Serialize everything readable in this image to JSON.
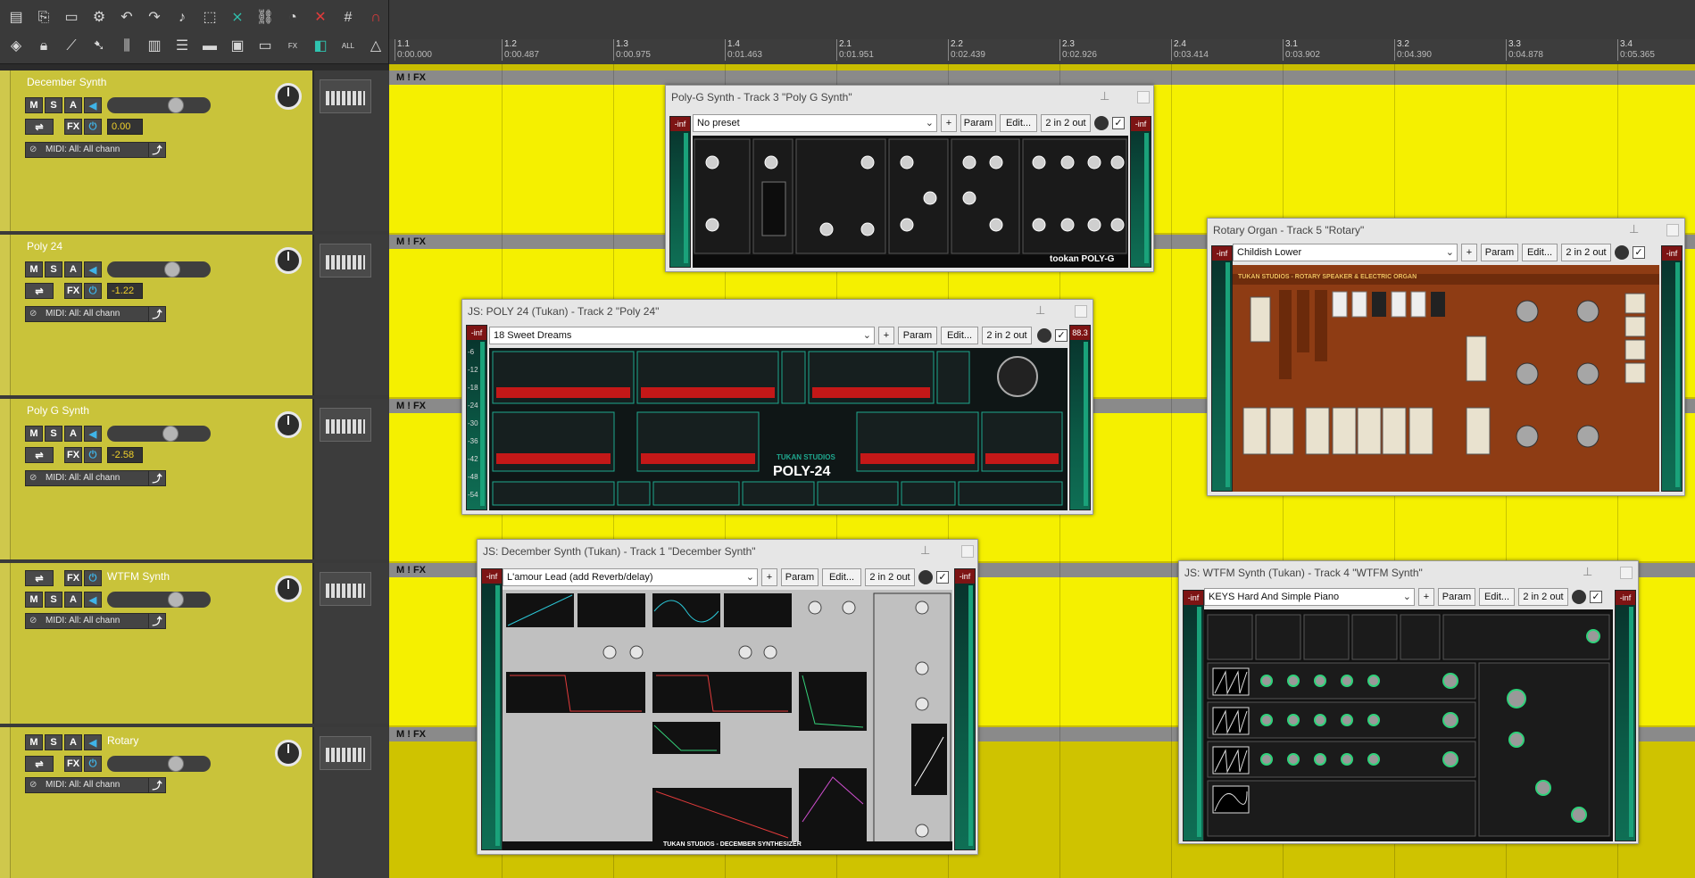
{
  "ruler": {
    "markers": [
      {
        "bar": "1.1",
        "time": "0:00.000"
      },
      {
        "bar": "1.2",
        "time": "0:00.487"
      },
      {
        "bar": "1.3",
        "time": "0:00.975"
      },
      {
        "bar": "1.4",
        "time": "0:01.463"
      },
      {
        "bar": "2.1",
        "time": "0:01.951"
      },
      {
        "bar": "2.2",
        "time": "0:02.439"
      },
      {
        "bar": "2.3",
        "time": "0:02.926"
      },
      {
        "bar": "2.4",
        "time": "0:03.414"
      },
      {
        "bar": "3.1",
        "time": "0:03.902"
      },
      {
        "bar": "3.2",
        "time": "0:04.390"
      },
      {
        "bar": "3.3",
        "time": "0:04.878"
      },
      {
        "bar": "3.4",
        "time": "0:05.365"
      }
    ]
  },
  "tracks": [
    {
      "name": "December Synth",
      "pan": "0.00",
      "midi": "MIDI: All: All chann"
    },
    {
      "name": "Poly 24",
      "pan": "-1.22",
      "midi": "MIDI: All: All chann"
    },
    {
      "name": "Poly G Synth",
      "pan": "-2.58",
      "midi": "MIDI: All: All chann"
    },
    {
      "name": "WTFM Synth",
      "midi": "MIDI: All: All chann"
    },
    {
      "name": "Rotary",
      "midi": "MIDI: All: All chann"
    }
  ],
  "buttons": {
    "m": "M",
    "s": "S",
    "a": "A",
    "fx": "FX"
  },
  "lane": {
    "flags": "M  !  FX"
  },
  "windows": {
    "polyg": {
      "title": "Poly-G Synth - Track 3 \"Poly G Synth\"",
      "preset": "No preset",
      "brand": "tookan POLY-G"
    },
    "poly24": {
      "title": "JS: POLY 24 (Tukan) - Track 2 \"Poly 24\"",
      "preset": "18 Sweet Dreams",
      "peak": "88.3",
      "brand": "POLY-24",
      "brand2": "TUKAN STUDIOS"
    },
    "december": {
      "title": "JS: December Synth (Tukan) - Track 1 \"December Synth\"",
      "preset": "L'amour Lead (add Reverb/delay)",
      "brand": "TUKAN STUDIOS - DECEMBER SYNTHESIZER"
    },
    "rotary": {
      "title": "Rotary Organ - Track 5 \"Rotary\"",
      "preset": "Childish Lower",
      "brand": "TUKAN STUDIOS - ROTARY SPEAKER & ELECTRIC ORGAN"
    },
    "wtfm": {
      "title": "JS: WTFM Synth (Tukan) - Track 4 \"WTFM Synth\"",
      "preset": "KEYS Hard And Simple Piano"
    }
  },
  "common": {
    "param": "Param",
    "edit": "Edit...",
    "io": "2 in 2 out",
    "plus": "+",
    "inf": "-inf",
    "check": "✓"
  },
  "meter_scale": [
    "-6",
    "-12",
    "-18",
    "-24",
    "-30",
    "-36",
    "-42",
    "-48",
    "-54"
  ],
  "colors": {
    "track": "#c9c33a",
    "lane": "#f5f000",
    "plugin_bg": "#111111",
    "accent_blue": "#3fb4e8",
    "accent_yellow": "#f2d22b"
  }
}
